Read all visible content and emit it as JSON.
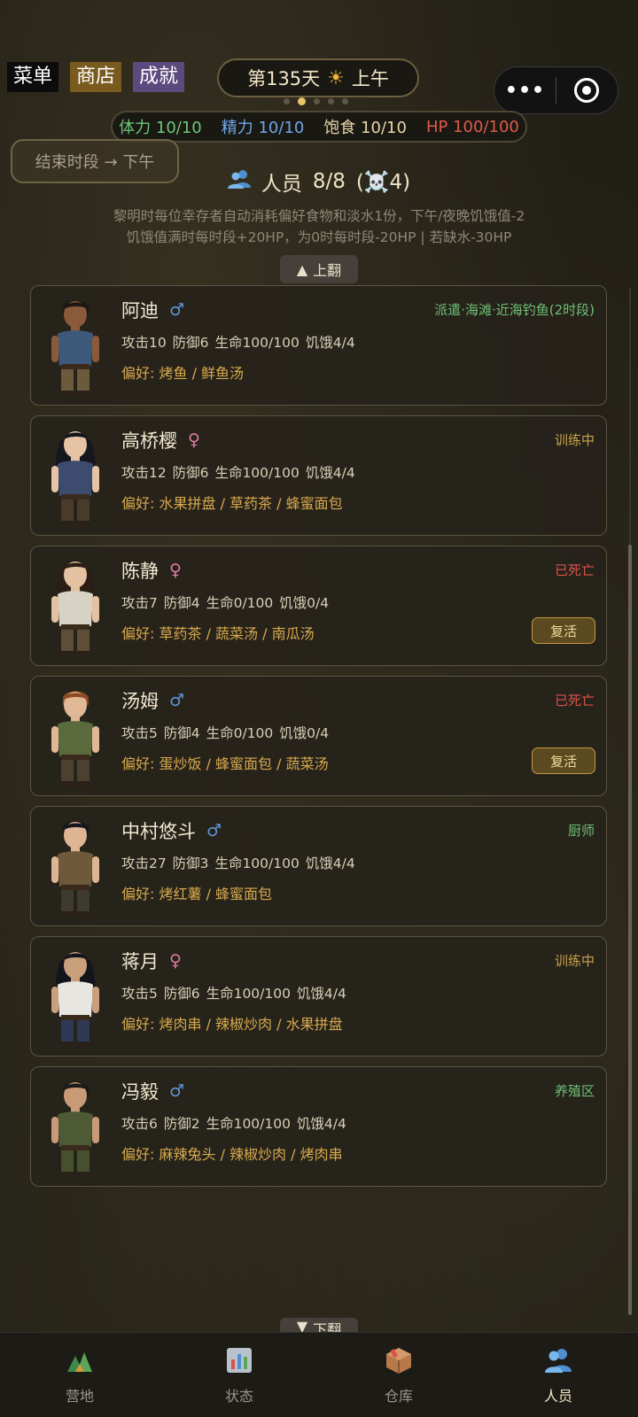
{
  "top_menu": {
    "menu": "菜单",
    "shop": "商店",
    "achievements": "成就"
  },
  "day": {
    "label": "第135天",
    "period": "上午",
    "icon": "sun-icon"
  },
  "page_dots": {
    "total": 5,
    "active": 1
  },
  "capsule": {
    "more": "•••",
    "target_icon": "target-icon"
  },
  "stats": {
    "stamina": "体力 10/10",
    "energy": "精力 10/10",
    "satiety": "饱食 10/10",
    "hp": "HP 100/100"
  },
  "end_period_button": "结束时段 → 下午",
  "people": {
    "title": "人员",
    "count": "8/8",
    "dead": "(☠️4)",
    "desc_line1": "黎明时每位幸存者自动消耗偏好食物和淡水1份，下午/夜晚饥饿值-2",
    "desc_line2": "饥饿值满时每时段+20HP，为0时每时段-20HP | 若缺水-30HP"
  },
  "pager": {
    "up": "上翻",
    "down": "下翻"
  },
  "survivors": [
    {
      "name": "阿迪",
      "gender": "♂",
      "status": "派遣·海滩·近海钓鱼(2时段)",
      "status_color": "green",
      "attrs": "攻击10  防御6  生命100/100  饥饿4/4",
      "prefs": "偏好: 烤鱼 / 鲜鱼汤",
      "revive": "",
      "avatar": {
        "skin": "#8a5a3a",
        "hair": "#1e1812",
        "shirt": "#3e5a7a",
        "pants": "#6b5a3c"
      }
    },
    {
      "name": "高桥樱",
      "gender": "♀",
      "status": "训练中",
      "status_color": "amber",
      "attrs": "攻击12  防御6  生命100/100  饥饿4/4",
      "prefs": "偏好: 水果拼盘 / 草药茶 / 蜂蜜面包",
      "revive": "",
      "avatar": {
        "skin": "#e6c3a4",
        "hair": "#15161e",
        "shirt": "#3d4b6e",
        "pants": "#4a3a2a"
      }
    },
    {
      "name": "陈静",
      "gender": "♀",
      "status": "已死亡",
      "status_color": "red",
      "attrs": "攻击7  防御4  生命0/100  饥饿0/4",
      "prefs": "偏好: 草药茶 / 蔬菜汤 / 南瓜汤",
      "revive": "复活",
      "avatar": {
        "skin": "#e4c1a0",
        "hair": "#2a1e16",
        "shirt": "#d6d2c4",
        "pants": "#5e4e38"
      }
    },
    {
      "name": "汤姆",
      "gender": "♂",
      "status": "已死亡",
      "status_color": "red",
      "attrs": "攻击5  防御4  生命0/100  饥饿0/4",
      "prefs": "偏好: 蛋炒饭 / 蜂蜜面包 / 蔬菜汤",
      "revive": "复活",
      "avatar": {
        "skin": "#e0b896",
        "hair": "#8a4a22",
        "shirt": "#5b6a3c",
        "pants": "#4e4030"
      }
    },
    {
      "name": "中村悠斗",
      "gender": "♂",
      "status": "厨师",
      "status_color": "green",
      "attrs": "攻击27  防御3  生命100/100  饥饿4/4",
      "prefs": "偏好: 烤红薯 / 蜂蜜面包",
      "revive": "",
      "avatar": {
        "skin": "#deb592",
        "hair": "#15161e",
        "shirt": "#6e5a3a",
        "pants": "#3e3a30"
      }
    },
    {
      "name": "蒋月",
      "gender": "♀",
      "status": "训练中",
      "status_color": "amber",
      "attrs": "攻击5  防御6  生命100/100  饥饿4/4",
      "prefs": "偏好: 烤肉串 / 辣椒炒肉 / 水果拼盘",
      "revive": "",
      "avatar": {
        "skin": "#caa07c",
        "hair": "#14151c",
        "shirt": "#e8e6e0",
        "pants": "#2e3a55"
      }
    },
    {
      "name": "冯毅",
      "gender": "♂",
      "status": "养殖区",
      "status_color": "green",
      "attrs": "攻击6  防御2  生命100/100  饥饿4/4",
      "prefs": "偏好: 麻辣兔头 / 辣椒炒肉 / 烤肉串",
      "revive": "",
      "avatar": {
        "skin": "#c99a76",
        "hair": "#1a1a1a",
        "shirt": "#4e5a36",
        "pants": "#46502e"
      }
    }
  ],
  "tabs": [
    {
      "label": "营地",
      "icon": "camp-icon",
      "active": false
    },
    {
      "label": "状态",
      "icon": "chart-icon",
      "active": false
    },
    {
      "label": "仓库",
      "icon": "box-icon",
      "active": false
    },
    {
      "label": "人员",
      "icon": "people-icon",
      "active": true
    }
  ]
}
